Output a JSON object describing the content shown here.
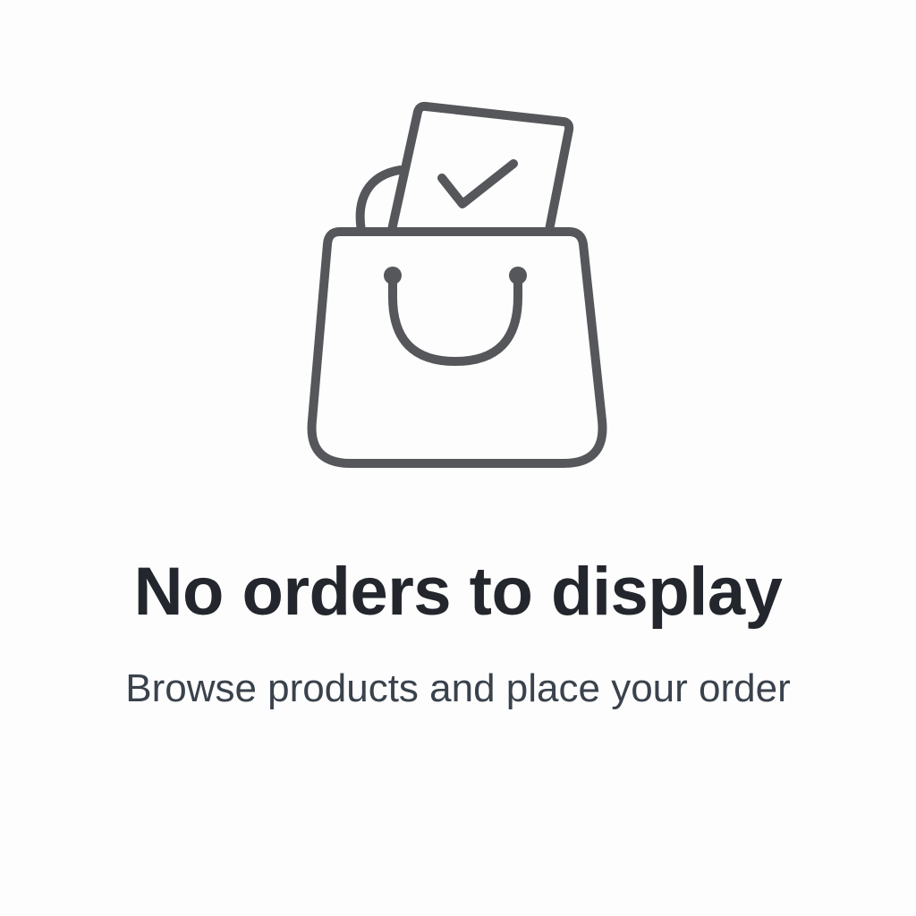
{
  "empty_state": {
    "icon": "shopping-bag-with-checked-receipt-icon",
    "icon_color": "#55575b",
    "title": "No orders to display",
    "subtitle": "Browse products and place your order"
  },
  "colors": {
    "background": "#fdfdfd",
    "title": "#23272d",
    "subtitle": "#3a424c"
  }
}
